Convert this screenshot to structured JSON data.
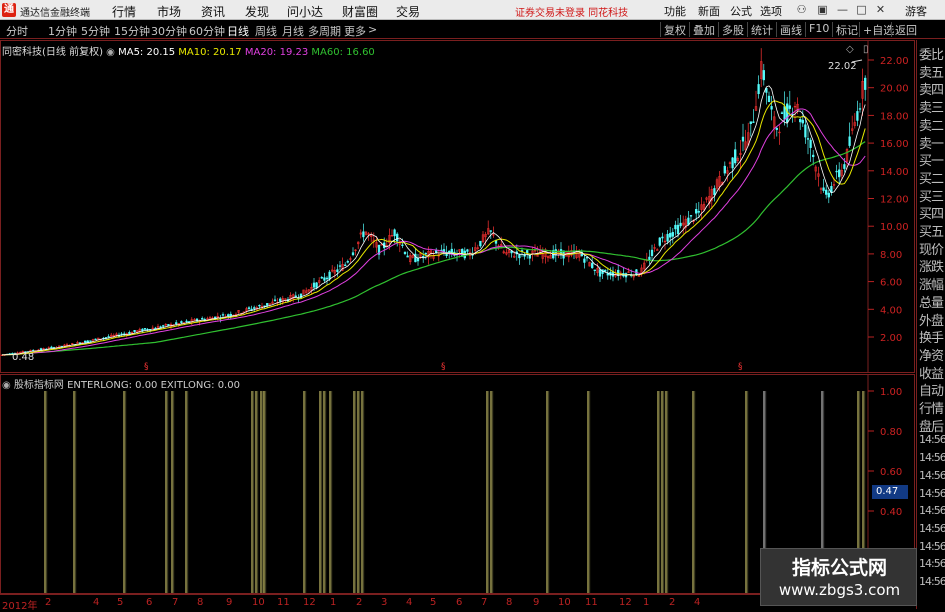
{
  "app": {
    "title": "通达信金融终端",
    "logo": "通"
  },
  "menu": [
    "行情",
    "市场",
    "资讯",
    "发现",
    "问小达",
    "财富圈",
    "交易"
  ],
  "banner": "证券交易未登录    同花科技",
  "right_menu": [
    "功能",
    "新面",
    "公式",
    "选项"
  ],
  "user": "游客",
  "periods": [
    "分时",
    "1分钟",
    "5分钟",
    "15分钟",
    "30分钟",
    "60分钟",
    "日线",
    "周线",
    "月线",
    "多周期",
    "更多"
  ],
  "active_period": "日线",
  "right_buttons": [
    "复权",
    "叠加",
    "多股",
    "统计",
    "画线",
    "F10",
    "标记",
    "+自选",
    "返回"
  ],
  "stock": {
    "name": "同密科技",
    "mode": "(日线 前复权)"
  },
  "ma": {
    "ma5": "MA5: 20.15",
    "ma10": "MA10: 20.17",
    "ma20": "MA20: 19.23",
    "ma60": "MA60: 16.60"
  },
  "indicator": {
    "name": "股标指标网",
    "enter": "ENTERLONG: 0.00",
    "exit": "EXITLONG: 0.00"
  },
  "high_label": "22.02",
  "low_label": "0.48",
  "price_scale": [
    "22.00",
    "20.00",
    "18.00",
    "16.00",
    "14.00",
    "12.00",
    "10.00",
    "8.00",
    "6.00",
    "4.00",
    "2.00"
  ],
  "sub_scale": [
    "1.00",
    "0.80",
    "0.60",
    "0.40"
  ],
  "current_value": "0.47",
  "side_panel": [
    "委比",
    "卖五",
    "卖四",
    "卖三",
    "卖二",
    "卖一",
    "买一",
    "买二",
    "买三",
    "买四",
    "买五",
    "现价",
    "涨跌",
    "涨幅",
    "总量",
    "外盘",
    "换手",
    "净资",
    "收益",
    "自动",
    "行情",
    "盘后",
    "14:56",
    "14:56",
    "14:56",
    "14:56",
    "14:56",
    "14:56",
    "14:56",
    "14:56",
    "14:56"
  ],
  "time_axis": [
    "2012年",
    "2",
    "4",
    "5",
    "6",
    "7",
    "8",
    "9",
    "10",
    "11",
    "12",
    "1",
    "2",
    "3",
    "4",
    "5",
    "6",
    "7",
    "8",
    "9",
    "10",
    "11",
    "12",
    "1",
    "2",
    "4"
  ],
  "watermark": {
    "line1": "指标公式网",
    "line2": "www.zbgs3.com"
  },
  "colors": {
    "ma5": "#ffffff",
    "ma10": "#e8e800",
    "ma20": "#e040e0",
    "ma60": "#30c030",
    "up": "#ff3232",
    "down": "#54fcfc",
    "signal": "#d8d070"
  }
}
